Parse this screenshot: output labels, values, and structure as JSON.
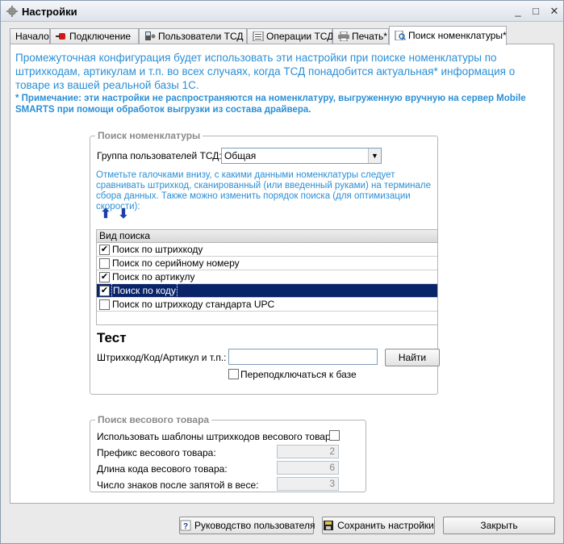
{
  "window": {
    "title": "Настройки",
    "buttons": {
      "minimize": "_",
      "maximize": "□",
      "close": "✕"
    }
  },
  "tabs": [
    {
      "label": "Начало",
      "icon": ""
    },
    {
      "label": "Подключение",
      "icon": "plug-icon"
    },
    {
      "label": "Пользователи ТСД",
      "icon": "users-device-icon"
    },
    {
      "label": "Операции ТСД",
      "icon": "list-icon"
    },
    {
      "label": "Печать*",
      "icon": "printer-icon"
    },
    {
      "label": "Поиск номенклатуры*",
      "icon": "search-doc-icon"
    }
  ],
  "active_tab": "Поиск номенклатуры*",
  "intro": "Промежуточная конфигурация будет использовать эти настройки при поиске номенклатуры по штрихкодам, артикулам и т.п. во всех случаях, когда ТСД понадобится актуальная* информация о товаре из вашей реальной базы 1С.",
  "note": "* Примечание:  эти настройки не распространяются на номенклатуру, выгруженную вручную на сервер Mobile SMARTS  при помощи обработок выгрузки из состава драйвера.",
  "search_group": {
    "legend": "Поиск номенклатуры",
    "user_group_label": "Группа пользователей ТСД:",
    "user_group_value": "Общая",
    "hint": "Отметьте галочками внизу, с какими данными номенклатуры следует сравнивать штрихкод, сканированный (или введенный руками) на терминале сбора данных. Также можно изменить порядок поиска (для оптимизации скорости):",
    "up_arrow": "⬆",
    "down_arrow": "⬇",
    "table_header": "Вид поиска",
    "rows": [
      {
        "label": "Поиск по штрихкоду",
        "checked": "✔"
      },
      {
        "label": "Поиск по серийному номеру",
        "checked": ""
      },
      {
        "label": "Поиск по артикулу",
        "checked": "✔"
      },
      {
        "label": "Поиск по коду",
        "checked": "✔"
      },
      {
        "label": "Поиск по штрихкоду стандарта UPC",
        "checked": ""
      }
    ],
    "selected_row": "Поиск по коду",
    "test_heading": "Тест",
    "test_label": "Штрихкод/Код/Артикул и т.п.:",
    "test_value": "",
    "find_button": "Найти",
    "reconnect_label": "Переподключаться к базе"
  },
  "weight_group": {
    "legend": "Поиск весового товара",
    "use_templates_label": "Использовать шаблоны штрихкодов весового товара",
    "prefix_label": "Префикс весового товара:",
    "prefix_value": "2",
    "code_length_label": "Длина кода весового товара:",
    "code_length_value": "6",
    "decimals_label": "Число знаков после запятой в весе:",
    "decimals_value": "3"
  },
  "footer": {
    "manual_button": "Руководство пользователя",
    "save_button": "Сохранить настройки",
    "close_button": "Закрыть"
  }
}
